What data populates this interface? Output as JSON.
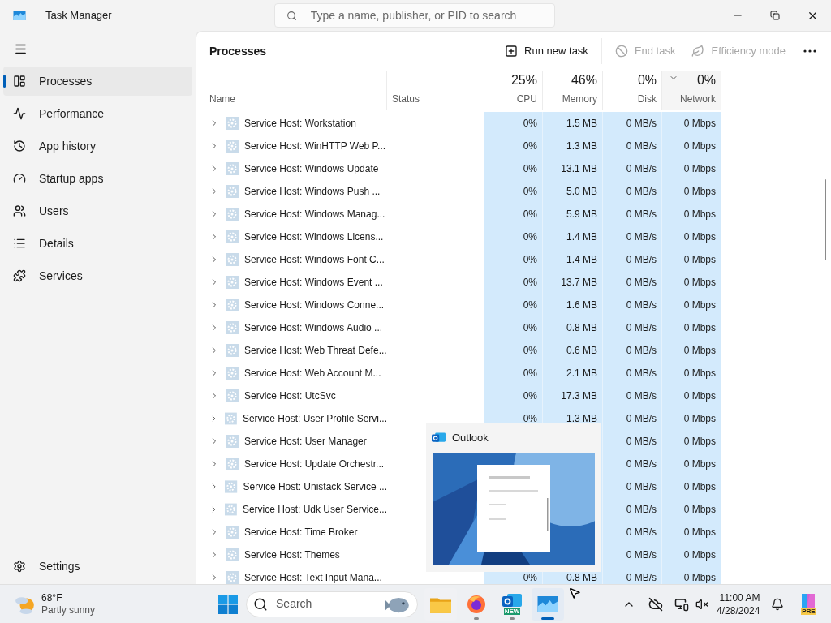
{
  "window": {
    "title": "Task Manager",
    "search_placeholder": "Type a name, publisher, or PID to search"
  },
  "sidebar": {
    "items": [
      {
        "label": "Processes",
        "selected": true
      },
      {
        "label": "Performance",
        "selected": false
      },
      {
        "label": "App history",
        "selected": false
      },
      {
        "label": "Startup apps",
        "selected": false
      },
      {
        "label": "Users",
        "selected": false
      },
      {
        "label": "Details",
        "selected": false
      },
      {
        "label": "Services",
        "selected": false
      }
    ],
    "footer": {
      "label": "Settings"
    }
  },
  "page": {
    "title": "Processes",
    "toolbar": [
      {
        "kind": "run",
        "label": "Run new task",
        "disabled": false
      },
      {
        "kind": "end",
        "label": "End task",
        "disabled": true
      },
      {
        "kind": "efficiency",
        "label": "Efficiency mode",
        "disabled": true
      }
    ]
  },
  "table": {
    "columns": [
      {
        "label": "Name"
      },
      {
        "label": "Status"
      },
      {
        "label": "CPU",
        "total": "25%",
        "sorted": false
      },
      {
        "label": "Memory",
        "total": "46%",
        "sorted": false
      },
      {
        "label": "Disk",
        "total": "0%",
        "sorted": false
      },
      {
        "label": "Network",
        "total": "0%",
        "sorted": true
      }
    ],
    "rows": [
      {
        "name": "Service Host: Workstation",
        "cpu": "0%",
        "memory": "1.5 MB",
        "disk": "0 MB/s",
        "network": "0 Mbps"
      },
      {
        "name": "Service Host: WinHTTP Web P...",
        "cpu": "0%",
        "memory": "1.3 MB",
        "disk": "0 MB/s",
        "network": "0 Mbps"
      },
      {
        "name": "Service Host: Windows Update",
        "cpu": "0%",
        "memory": "13.1 MB",
        "disk": "0 MB/s",
        "network": "0 Mbps"
      },
      {
        "name": "Service Host: Windows Push ...",
        "cpu": "0%",
        "memory": "5.0 MB",
        "disk": "0 MB/s",
        "network": "0 Mbps"
      },
      {
        "name": "Service Host: Windows Manag...",
        "cpu": "0%",
        "memory": "5.9 MB",
        "disk": "0 MB/s",
        "network": "0 Mbps"
      },
      {
        "name": "Service Host: Windows Licens...",
        "cpu": "0%",
        "memory": "1.4 MB",
        "disk": "0 MB/s",
        "network": "0 Mbps"
      },
      {
        "name": "Service Host: Windows Font C...",
        "cpu": "0%",
        "memory": "1.4 MB",
        "disk": "0 MB/s",
        "network": "0 Mbps"
      },
      {
        "name": "Service Host: Windows Event ...",
        "cpu": "0%",
        "memory": "13.7 MB",
        "disk": "0 MB/s",
        "network": "0 Mbps"
      },
      {
        "name": "Service Host: Windows Conne...",
        "cpu": "0%",
        "memory": "1.6 MB",
        "disk": "0 MB/s",
        "network": "0 Mbps"
      },
      {
        "name": "Service Host: Windows Audio ...",
        "cpu": "0%",
        "memory": "0.8 MB",
        "disk": "0 MB/s",
        "network": "0 Mbps"
      },
      {
        "name": "Service Host: Web Threat Defe...",
        "cpu": "0%",
        "memory": "0.6 MB",
        "disk": "0 MB/s",
        "network": "0 Mbps"
      },
      {
        "name": "Service Host: Web Account M...",
        "cpu": "0%",
        "memory": "2.1 MB",
        "disk": "0 MB/s",
        "network": "0 Mbps"
      },
      {
        "name": "Service Host: UtcSvc",
        "cpu": "0%",
        "memory": "17.3 MB",
        "disk": "0 MB/s",
        "network": "0 Mbps"
      },
      {
        "name": "Service Host: User Profile Servi...",
        "cpu": "0%",
        "memory": "1.3 MB",
        "disk": "0 MB/s",
        "network": "0 Mbps"
      },
      {
        "name": "Service Host: User Manager",
        "disk": "0 MB/s",
        "network": "0 Mbps"
      },
      {
        "name": "Service Host: Update Orchestr...",
        "disk": "0 MB/s",
        "network": "0 Mbps"
      },
      {
        "name": "Service Host: Unistack Service ...",
        "disk": "0 MB/s",
        "network": "0 Mbps"
      },
      {
        "name": "Service Host: Udk User Service...",
        "disk": "0 MB/s",
        "network": "0 Mbps"
      },
      {
        "name": "Service Host: Time Broker",
        "disk": "0 MB/s",
        "network": "0 Mbps"
      },
      {
        "name": "Service Host: Themes",
        "disk": "0 MB/s",
        "network": "0 Mbps"
      },
      {
        "name": "Service Host: Text Input Mana...",
        "cpu": "0%",
        "memory": "0.8 MB",
        "disk": "0 MB/s",
        "network": "0 Mbps"
      }
    ]
  },
  "preview": {
    "title": "Outlook",
    "kind": "picture"
  },
  "taskbar": {
    "weather": {
      "temp": "68°F",
      "condition": "Partly sunny"
    },
    "search_placeholder": "Search",
    "apps": [
      {
        "kind": "explorer",
        "running": false,
        "active": false
      },
      {
        "kind": "firefox",
        "running": true,
        "active": false
      },
      {
        "kind": "outlook",
        "running": true,
        "active": false,
        "badge": "NEW"
      },
      {
        "kind": "taskmanager",
        "running": true,
        "active": true
      }
    ],
    "time": "11:00 AM",
    "date": "4/28/2024",
    "copilot_badge": "PRE"
  }
}
